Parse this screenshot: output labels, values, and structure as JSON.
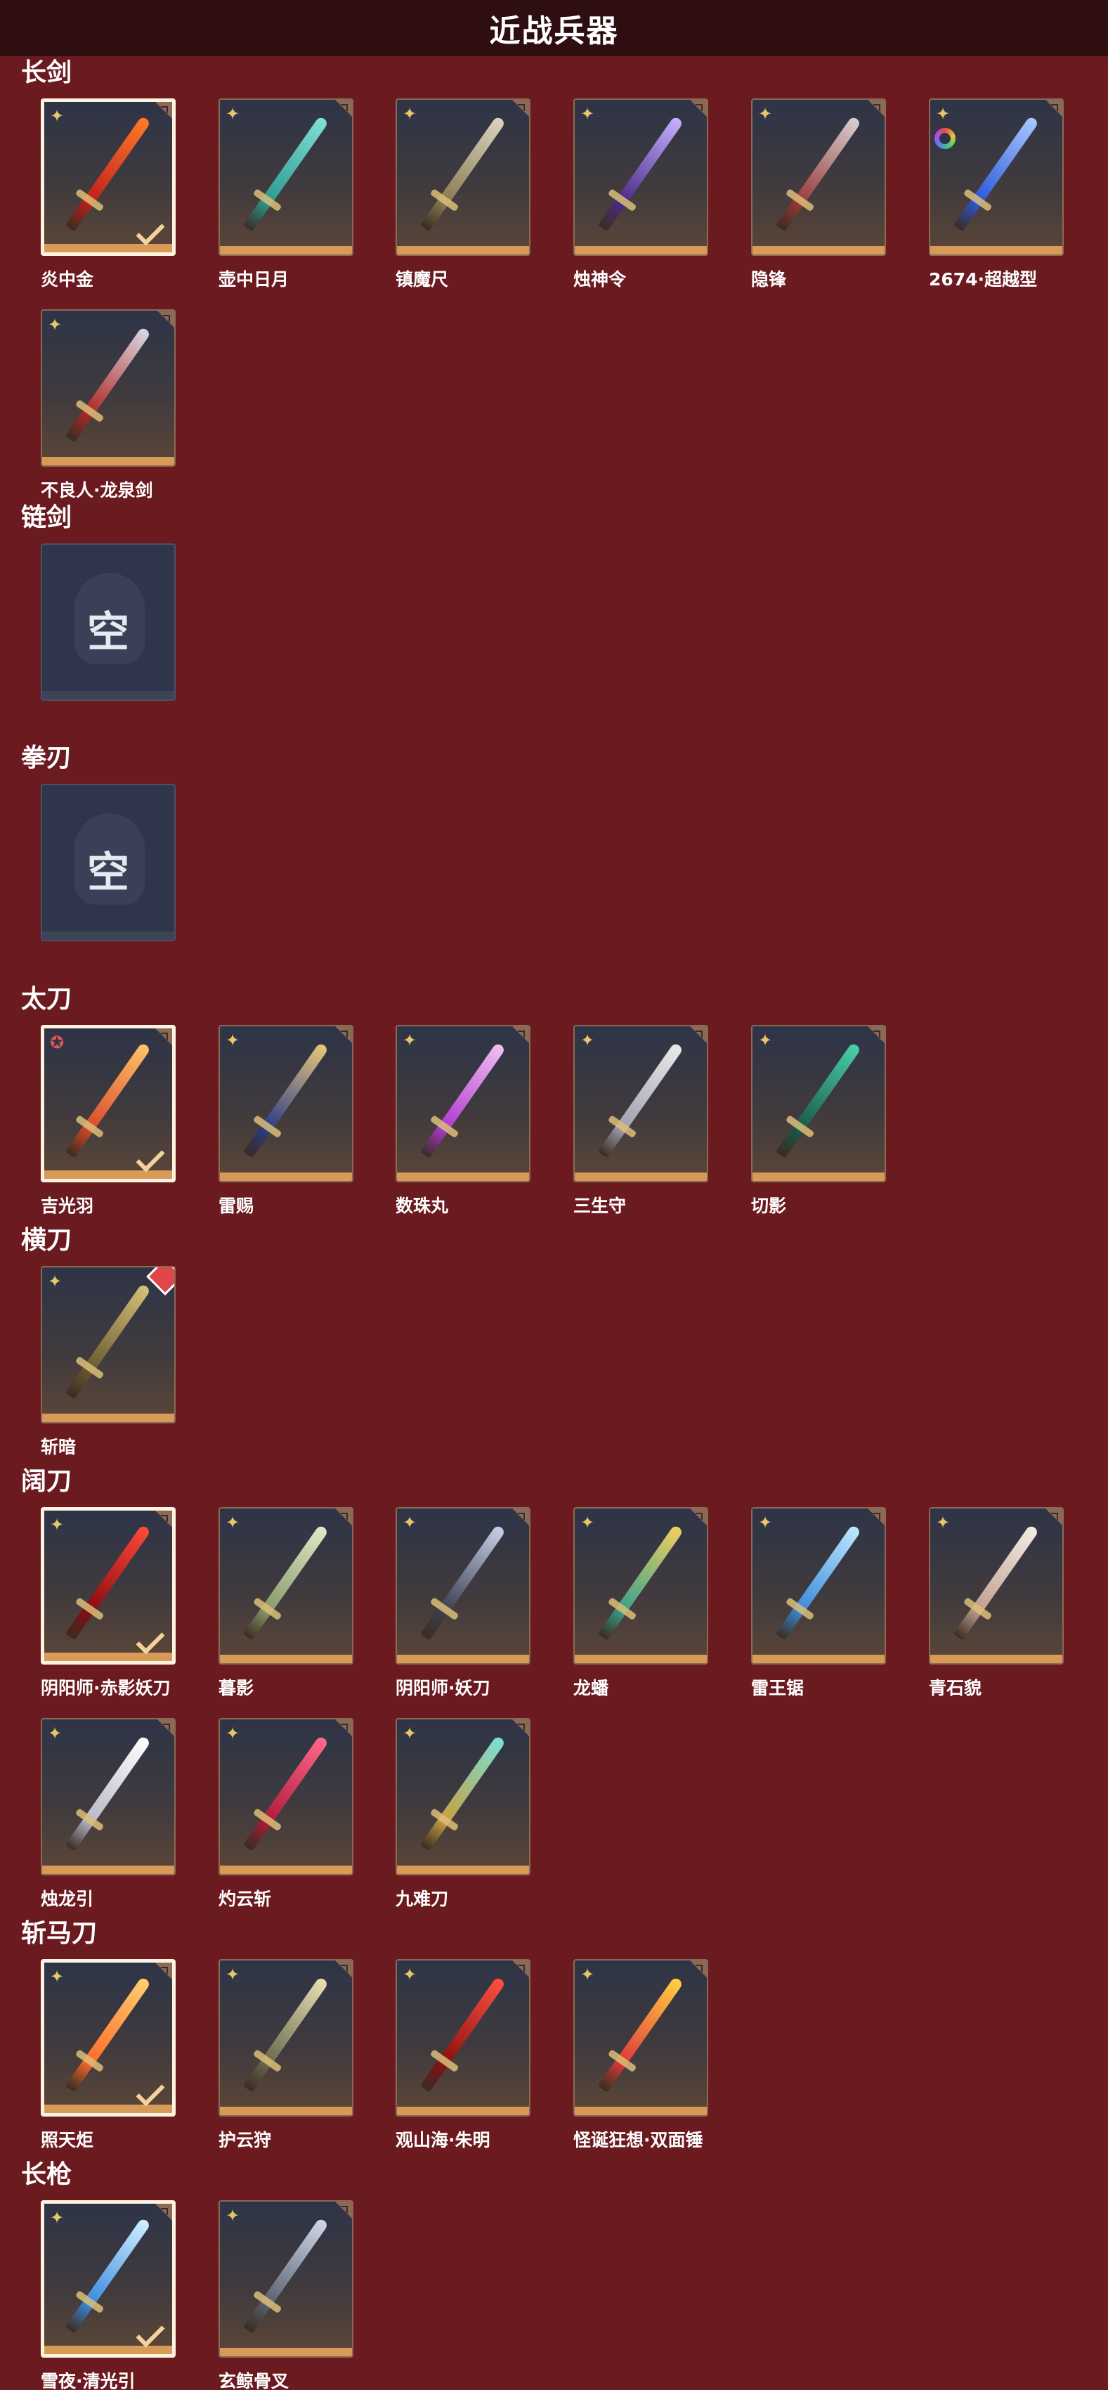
{
  "header": {
    "title": "近战兵器"
  },
  "empty_label": "空",
  "sections": [
    {
      "title": "长剑",
      "items": [
        {
          "name": "炎中金",
          "colors": [
            "#ff7a2a",
            "#c0201a"
          ],
          "selected": true,
          "badge": "gold-star"
        },
        {
          "name": "壶中日月",
          "colors": [
            "#7fe0d6",
            "#2d9a90"
          ],
          "selected": false,
          "badge": "gold-star"
        },
        {
          "name": "镇魔尺",
          "colors": [
            "#d9d4c0",
            "#8a7c52"
          ],
          "selected": false,
          "badge": "gold-star"
        },
        {
          "name": "烛神令",
          "colors": [
            "#c6b0ff",
            "#4a2b88"
          ],
          "selected": false,
          "badge": "gold-star"
        },
        {
          "name": "隐锋",
          "colors": [
            "#d6d0d0",
            "#9a3a3a"
          ],
          "selected": false,
          "badge": "gold-star"
        },
        {
          "name": "2674·超越型",
          "colors": [
            "#a8c8ff",
            "#2c58d8"
          ],
          "selected": false,
          "badge": "gold-star",
          "ring": true
        },
        {
          "name": "不良人·龙泉剑",
          "colors": [
            "#d8d8e0",
            "#b02828"
          ],
          "selected": false,
          "badge": "gold-star"
        }
      ]
    },
    {
      "title": "链剑",
      "items": [
        {
          "empty": true
        }
      ]
    },
    {
      "title": "拳刃",
      "items": [
        {
          "empty": true
        }
      ]
    },
    {
      "title": "太刀",
      "items": [
        {
          "name": "吉光羽",
          "colors": [
            "#ffc46a",
            "#d94a2a"
          ],
          "selected": true,
          "badge": "red-star"
        },
        {
          "name": "雷赐",
          "colors": [
            "#e8c878",
            "#2a3c8a"
          ],
          "selected": false,
          "badge": "gold-star"
        },
        {
          "name": "数珠丸",
          "colors": [
            "#f0c0f0",
            "#b03ad0"
          ],
          "selected": false,
          "badge": "gold-star"
        },
        {
          "name": "三生守",
          "colors": [
            "#eaeaea",
            "#a0a0b0"
          ],
          "selected": false,
          "badge": "gold-star"
        },
        {
          "name": "切影",
          "colors": [
            "#4ad0a8",
            "#1a5a48"
          ],
          "selected": false,
          "badge": "gold-star"
        }
      ]
    },
    {
      "title": "横刀",
      "items": [
        {
          "name": "斩暗",
          "colors": [
            "#d8c078",
            "#6a5a30"
          ],
          "selected": false,
          "badge": "gold-star",
          "red_diamond": true
        }
      ]
    },
    {
      "title": "阔刀",
      "items": [
        {
          "name": "阴阳师·赤影妖刀",
          "colors": [
            "#ff4a3a",
            "#8a0a10"
          ],
          "selected": true,
          "badge": "gold-star"
        },
        {
          "name": "暮影",
          "colors": [
            "#e0e8c8",
            "#8a9a6a"
          ],
          "selected": false,
          "badge": "gold-star"
        },
        {
          "name": "阴阳师·妖刀",
          "colors": [
            "#c8d0e8",
            "#3a4050"
          ],
          "selected": false,
          "badge": "gold-star"
        },
        {
          "name": "龙蟠",
          "colors": [
            "#f0d060",
            "#3aa08a"
          ],
          "selected": false,
          "badge": "gold-star"
        },
        {
          "name": "雷王锯",
          "colors": [
            "#bfe8ff",
            "#3a8ad8"
          ],
          "selected": false,
          "badge": "gold-star"
        },
        {
          "name": "青石貌",
          "colors": [
            "#f4ece4",
            "#c0a090"
          ],
          "selected": false,
          "badge": "gold-star"
        },
        {
          "name": "烛龙引",
          "colors": [
            "#ffffff",
            "#b8b8c8"
          ],
          "selected": false,
          "badge": "gold-star"
        },
        {
          "name": "灼云斩",
          "colors": [
            "#ff6a8a",
            "#b01a3a"
          ],
          "selected": false,
          "badge": "gold-star"
        },
        {
          "name": "九难刀",
          "colors": [
            "#7ae0d8",
            "#c8a040"
          ],
          "selected": false,
          "badge": "gold-star"
        }
      ]
    },
    {
      "title": "斩马刀",
      "items": [
        {
          "name": "照天炬",
          "colors": [
            "#ffd070",
            "#ff6a2a"
          ],
          "selected": true,
          "badge": "gold-star"
        },
        {
          "name": "护云狩",
          "colors": [
            "#e8e0b0",
            "#6a6a50"
          ],
          "selected": false,
          "badge": "gold-star"
        },
        {
          "name": "观山海·朱明",
          "colors": [
            "#ff5040",
            "#8a1010"
          ],
          "selected": false,
          "badge": "gold-star"
        },
        {
          "name": "怪诞狂想·双面锤",
          "colors": [
            "#ffd040",
            "#e03a3a"
          ],
          "selected": false,
          "badge": "gold-star"
        }
      ]
    },
    {
      "title": "长枪",
      "items": [
        {
          "name": "雪夜·清光引",
          "colors": [
            "#d0f0ff",
            "#3a8ae0"
          ],
          "selected": true,
          "badge": "gold-star"
        },
        {
          "name": "玄鲸骨叉",
          "colors": [
            "#d0d8e8",
            "#5a6070"
          ],
          "selected": false,
          "badge": "gold-star"
        }
      ]
    }
  ]
}
